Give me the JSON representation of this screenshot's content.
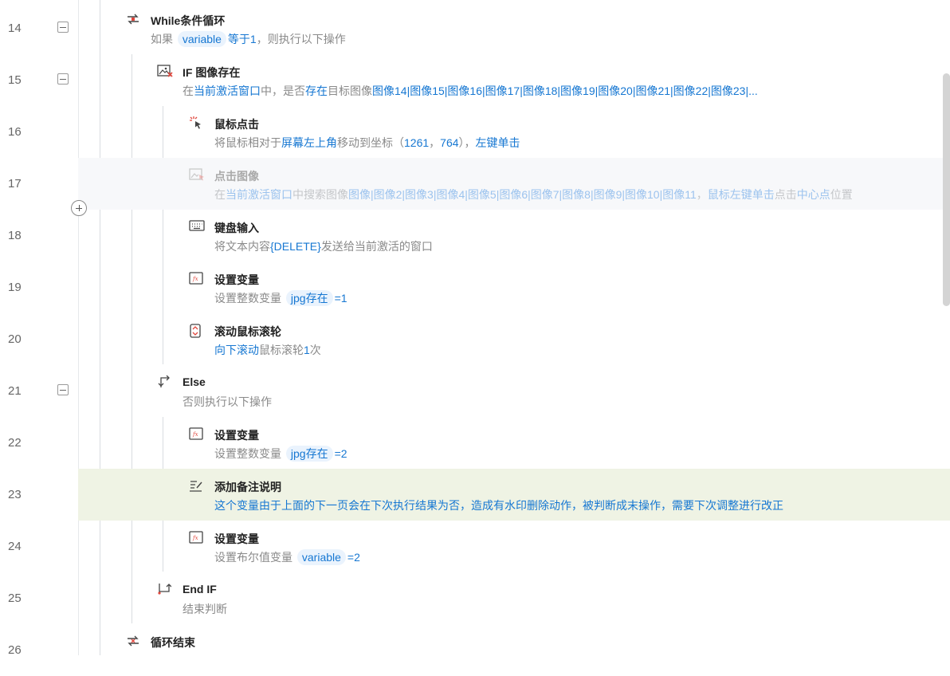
{
  "rows": [
    {
      "line": "14",
      "title": "While条件循环",
      "icon": "loop-icon",
      "desc": [
        {
          "t": "如果 "
        },
        {
          "tag": "variable"
        },
        {
          "l": "等于1"
        },
        {
          "t": "，则执行以下操作"
        }
      ]
    },
    {
      "line": "15",
      "title": "IF 图像存在",
      "icon": "image-exists-icon",
      "desc": [
        {
          "t": "在"
        },
        {
          "l": "当前激活窗口"
        },
        {
          "t": "中，是否"
        },
        {
          "l": "存在"
        },
        {
          "t": "目标图像"
        },
        {
          "l": "图像14|图像15|图像16|图像17|图像18|图像19|图像20|图像21|图像22|图像23|..."
        }
      ]
    },
    {
      "line": "16",
      "title": "鼠标点击",
      "icon": "mouse-click-icon",
      "desc": [
        {
          "t": "将鼠标相对于"
        },
        {
          "l": "屏幕左上角"
        },
        {
          "t": "移动到坐标（"
        },
        {
          "l": "1261"
        },
        {
          "t": "，"
        },
        {
          "l": "764"
        },
        {
          "t": "），"
        },
        {
          "l": "左键单击"
        }
      ]
    },
    {
      "line": "17",
      "title": "点击图像",
      "icon": "click-image-icon",
      "desc": [
        {
          "t": "在"
        },
        {
          "l": "当前激活窗口"
        },
        {
          "t": "中搜索图像"
        },
        {
          "l": "图像|图像2|图像3|图像4|图像5|图像6|图像7|图像8|图像9|图像10|图像11"
        },
        {
          "t": "，"
        },
        {
          "l": "鼠标左键单击"
        },
        {
          "t": "点击"
        },
        {
          "l": "中心点"
        },
        {
          "t": "位置"
        }
      ]
    },
    {
      "line": "18",
      "title": "键盘输入",
      "icon": "keyboard-icon",
      "desc": [
        {
          "t": "将文本内容"
        },
        {
          "l": "{DELETE}"
        },
        {
          "t": "发送给当前激活的窗口"
        }
      ]
    },
    {
      "line": "19",
      "title": "设置变量",
      "icon": "set-variable-icon",
      "desc": [
        {
          "t": "设置整数变量 "
        },
        {
          "tag": "jpg存在"
        },
        {
          "l": "=1"
        }
      ]
    },
    {
      "line": "20",
      "title": "滚动鼠标滚轮",
      "icon": "scroll-wheel-icon",
      "desc": [
        {
          "l": "向下滚动"
        },
        {
          "t": "鼠标滚轮"
        },
        {
          "l": "1"
        },
        {
          "t": "次"
        }
      ]
    },
    {
      "line": "21",
      "title": "Else",
      "icon": "else-icon",
      "desc": [
        {
          "t": "否则执行以下操作"
        }
      ]
    },
    {
      "line": "22",
      "title": "设置变量",
      "icon": "set-variable-icon",
      "desc": [
        {
          "t": "设置整数变量 "
        },
        {
          "tag": "jpg存在"
        },
        {
          "l": "=2"
        }
      ]
    },
    {
      "line": "23",
      "title": "添加备注说明",
      "icon": "note-icon",
      "desc": [
        {
          "l": "这个变量由于上面的下一页会在下次执行结果为否，造成有水印删除动作，被判断成末操作，需要下次调整进行改正"
        }
      ]
    },
    {
      "line": "24",
      "title": "设置变量",
      "icon": "set-variable-icon",
      "desc": [
        {
          "t": "设置布尔值变量 "
        },
        {
          "tag": "variable"
        },
        {
          "l": "=2"
        }
      ]
    },
    {
      "line": "25",
      "title": "End IF",
      "icon": "end-if-icon",
      "desc": [
        {
          "t": "结束判断"
        }
      ]
    },
    {
      "line": "26",
      "title": "循环结束",
      "icon": "loop-end-icon",
      "desc": []
    }
  ],
  "colors": {
    "link": "#1677d2",
    "note_bg": "#eff3e4",
    "disabled_bg": "#f7f8fa",
    "icon_red": "#e0463c"
  }
}
